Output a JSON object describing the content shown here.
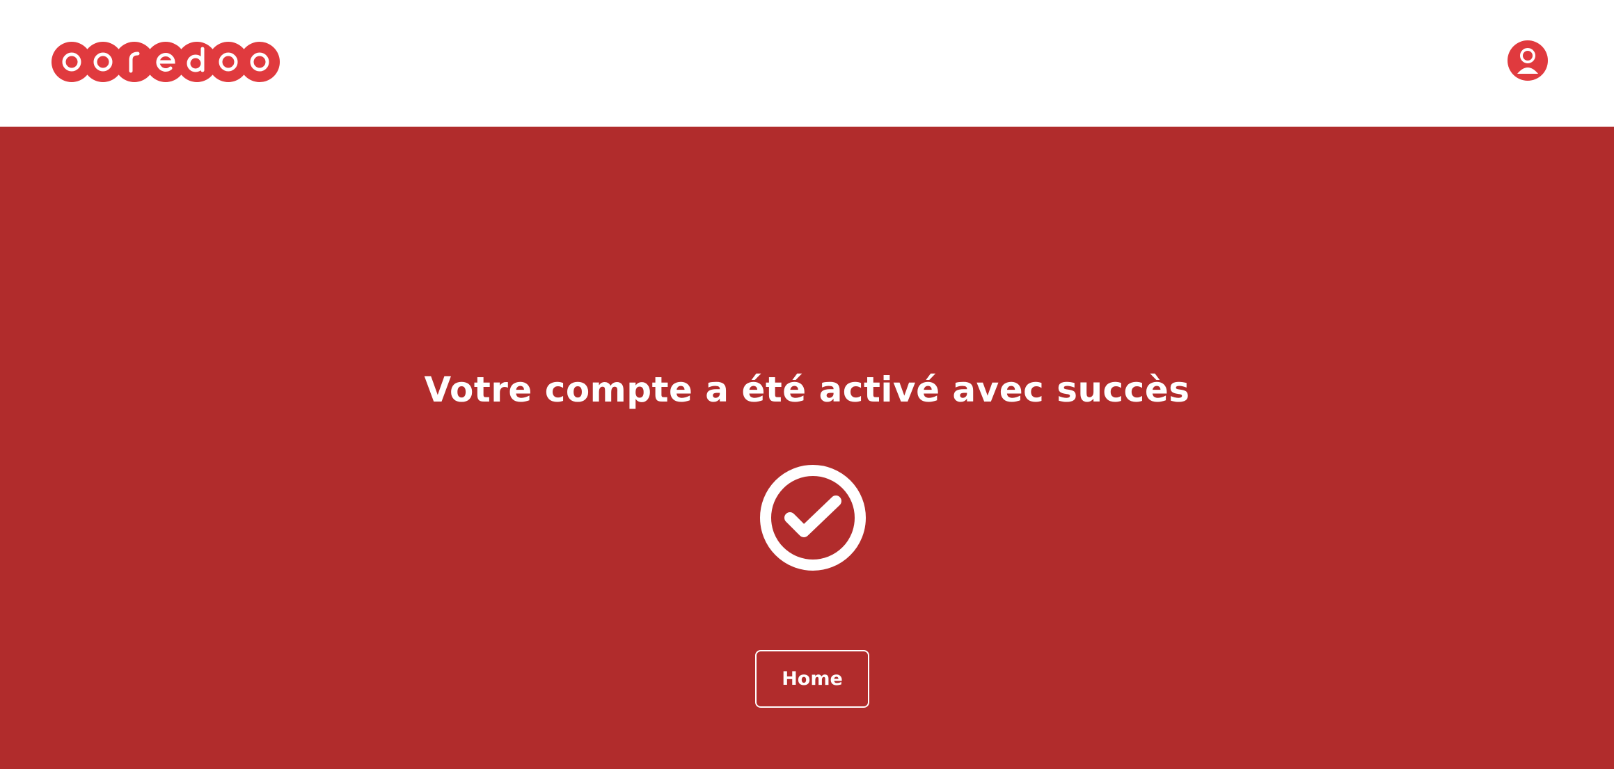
{
  "header": {
    "logo": {
      "name": "ooredoo",
      "letters": [
        "o",
        "o",
        "r",
        "e",
        "d",
        "o",
        "o"
      ],
      "color": "#e03a3e"
    },
    "account_icon": "user-account-icon"
  },
  "main": {
    "background": "#b12c2c",
    "message": "Votre compte a été activé avec succès",
    "status_icon": "check-circle-icon",
    "home_button_label": "Home"
  }
}
